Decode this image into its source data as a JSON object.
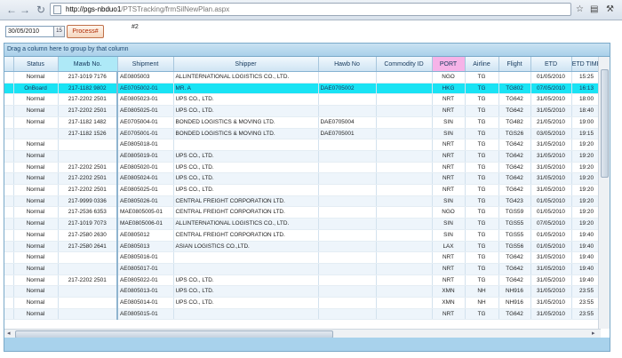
{
  "browser": {
    "url_host": "http://pgs-nbduo1",
    "url_path": "/PTSTracking/frmSilNewPlan.aspx",
    "back_glyph": "←",
    "forward_glyph": "→",
    "refresh_glyph": "↻",
    "home_glyph": "⌂",
    "star_glyph": "☆",
    "page_menu_glyph": "▤",
    "tools_glyph": "⚒"
  },
  "toolbar": {
    "date_value": "30/05/2010",
    "calendar_glyph": "15",
    "process_label": "Process#",
    "hash_label": "#2"
  },
  "grid": {
    "group_hint": "Drag a column here to group by that column",
    "columns": [
      "Status",
      "Mawb No.",
      "Shipment",
      "Shipper",
      "Hawb No",
      "Commodity ID",
      "PORT",
      "Airline",
      "Flight",
      "ETD",
      "ETD TIME"
    ],
    "rows": [
      [
        "Normal",
        "217-1019 7176",
        "AE0805003",
        "ALLINTERNATIONAL LOGISTICS CO., LTD.",
        "",
        "",
        "NGO",
        "TG",
        "",
        "01/05/2010",
        "15:25"
      ],
      [
        "OnBoard",
        "217-1182 9802",
        "AE0705002-01",
        "MR. A",
        "DAE0705002",
        "",
        "HKG",
        "TG",
        "TG802",
        "07/05/2010",
        "16:13"
      ],
      [
        "Normal",
        "217-2202 2501",
        "AE0805023-01",
        "UPS CO., LTD.",
        "",
        "",
        "NRT",
        "TG",
        "TG642",
        "31/05/2010",
        "18:00"
      ],
      [
        "Normal",
        "217-2202 2501",
        "AE0805025-01",
        "UPS CO., LTD.",
        "",
        "",
        "NRT",
        "TG",
        "TG642",
        "31/05/2010",
        "18:40"
      ],
      [
        "Normal",
        "217-1182 1482",
        "AE0705004-01",
        "BONDED LOGISTICS & MOVING LTD.",
        "DAE0705004",
        "",
        "SIN",
        "TG",
        "TG482",
        "21/05/2010",
        "19:00"
      ],
      [
        "",
        "217-1182 1526",
        "AE0705001-01",
        "BONDED LOGISTICS & MOVING LTD.",
        "DAE0705001",
        "",
        "SIN",
        "TG",
        "TGS26",
        "03/05/2010",
        "19:15"
      ],
      [
        "Normal",
        "",
        "AE0805018-01",
        "",
        "",
        "",
        "NRT",
        "TG",
        "TG642",
        "31/05/2010",
        "19:20"
      ],
      [
        "Normal",
        "",
        "AE0805019-01",
        "UPS CO., LTD.",
        "",
        "",
        "NRT",
        "TG",
        "TG642",
        "31/05/2010",
        "19:20"
      ],
      [
        "Normal",
        "217-2202 2501",
        "AE0805020-01",
        "UPS CO., LTD.",
        "",
        "",
        "NRT",
        "TG",
        "TG642",
        "31/05/2010",
        "19:20"
      ],
      [
        "Normal",
        "217-2202 2501",
        "AE0805024-01",
        "UPS CO., LTD.",
        "",
        "",
        "NRT",
        "TG",
        "TG642",
        "31/05/2010",
        "19:20"
      ],
      [
        "Normal",
        "217-2202 2501",
        "AE0805025-01",
        "UPS CO., LTD.",
        "",
        "",
        "NRT",
        "TG",
        "TG642",
        "31/05/2010",
        "19:20"
      ],
      [
        "Normal",
        "217-9999 0336",
        "AE0805026-01",
        "CENTRAL FREIGHT CORPORATION LTD.",
        "",
        "",
        "SIN",
        "TG",
        "TG423",
        "01/05/2010",
        "19:20"
      ],
      [
        "Normal",
        "217-2536 6353",
        "MAE0805005-01",
        "CENTRAL FREIGHT CORPORATION LTD.",
        "",
        "",
        "NGO",
        "TG",
        "TGS59",
        "01/05/2010",
        "19:20"
      ],
      [
        "Normal",
        "217-1019 7073",
        "MAE0805006-01",
        "ALLINTERNATIONAL LOGISTICS CO., LTD.",
        "",
        "",
        "SIN",
        "TG",
        "TGS55",
        "07/05/2010",
        "19:20"
      ],
      [
        "Normal",
        "217-2580 2630",
        "AE0805012",
        "CENTRAL FREIGHT CORPORATION LTD.",
        "",
        "",
        "SIN",
        "TG",
        "TGS55",
        "01/05/2010",
        "19:40"
      ],
      [
        "Normal",
        "217-2580 2641",
        "AE0805013",
        "ASIAN LOGISTICS CO.,LTD.",
        "",
        "",
        "LAX",
        "TG",
        "TGS56",
        "01/05/2010",
        "19:40"
      ],
      [
        "Normal",
        "",
        "AE0805016-01",
        "",
        "",
        "",
        "NRT",
        "TG",
        "TG642",
        "31/05/2010",
        "19:40"
      ],
      [
        "Normal",
        "",
        "AE0805017-01",
        "",
        "",
        "",
        "NRT",
        "TG",
        "TG642",
        "31/05/2010",
        "19:40"
      ],
      [
        "Normal",
        "217-2202 2501",
        "AE0805022-01",
        "UPS CO., LTD.",
        "",
        "",
        "NRT",
        "TG",
        "TG642",
        "31/05/2010",
        "19:40"
      ],
      [
        "Normal",
        "",
        "AE0805013-01",
        "UPS CO., LTD.",
        "",
        "",
        "XMN",
        "NH",
        "NH916",
        "31/05/2010",
        "23:55"
      ],
      [
        "Normal",
        "",
        "AE0805014-01",
        "UPS CO., LTD.",
        "",
        "",
        "XMN",
        "NH",
        "NH916",
        "31/05/2010",
        "23:55"
      ],
      [
        "Normal",
        "",
        "AE0805015-01",
        "",
        "",
        "",
        "NRT",
        "TG",
        "TG642",
        "31/05/2010",
        "23:55"
      ]
    ],
    "selected_row": 1
  }
}
